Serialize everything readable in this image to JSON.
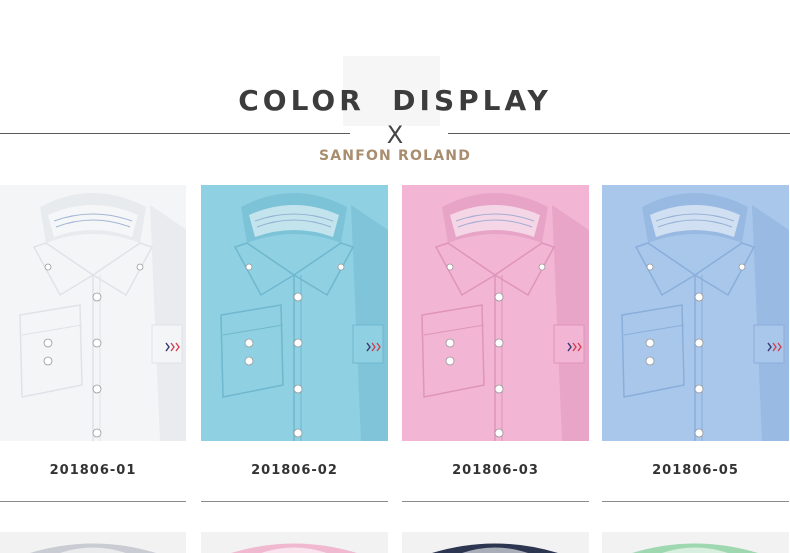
{
  "header": {
    "title": "COLOR  DISPLAY",
    "separator": "X",
    "brand": "SANFON ROLAND"
  },
  "products": [
    {
      "code": "201806-01",
      "color": "#f4f5f7",
      "shade": "#dfe2e7"
    },
    {
      "code": "201806-02",
      "color": "#8fd0e2",
      "shade": "#6fb8cf"
    },
    {
      "code": "201806-03",
      "color": "#f2b5d4",
      "shade": "#df95bb"
    },
    {
      "code": "201806-05",
      "color": "#a9c7ea",
      "shade": "#8aaedb"
    }
  ],
  "next_row": [
    {
      "color": "#c9ccd3"
    },
    {
      "color": "#f0b9cf"
    },
    {
      "color": "#2c3650"
    },
    {
      "color": "#9fd8b0"
    }
  ]
}
